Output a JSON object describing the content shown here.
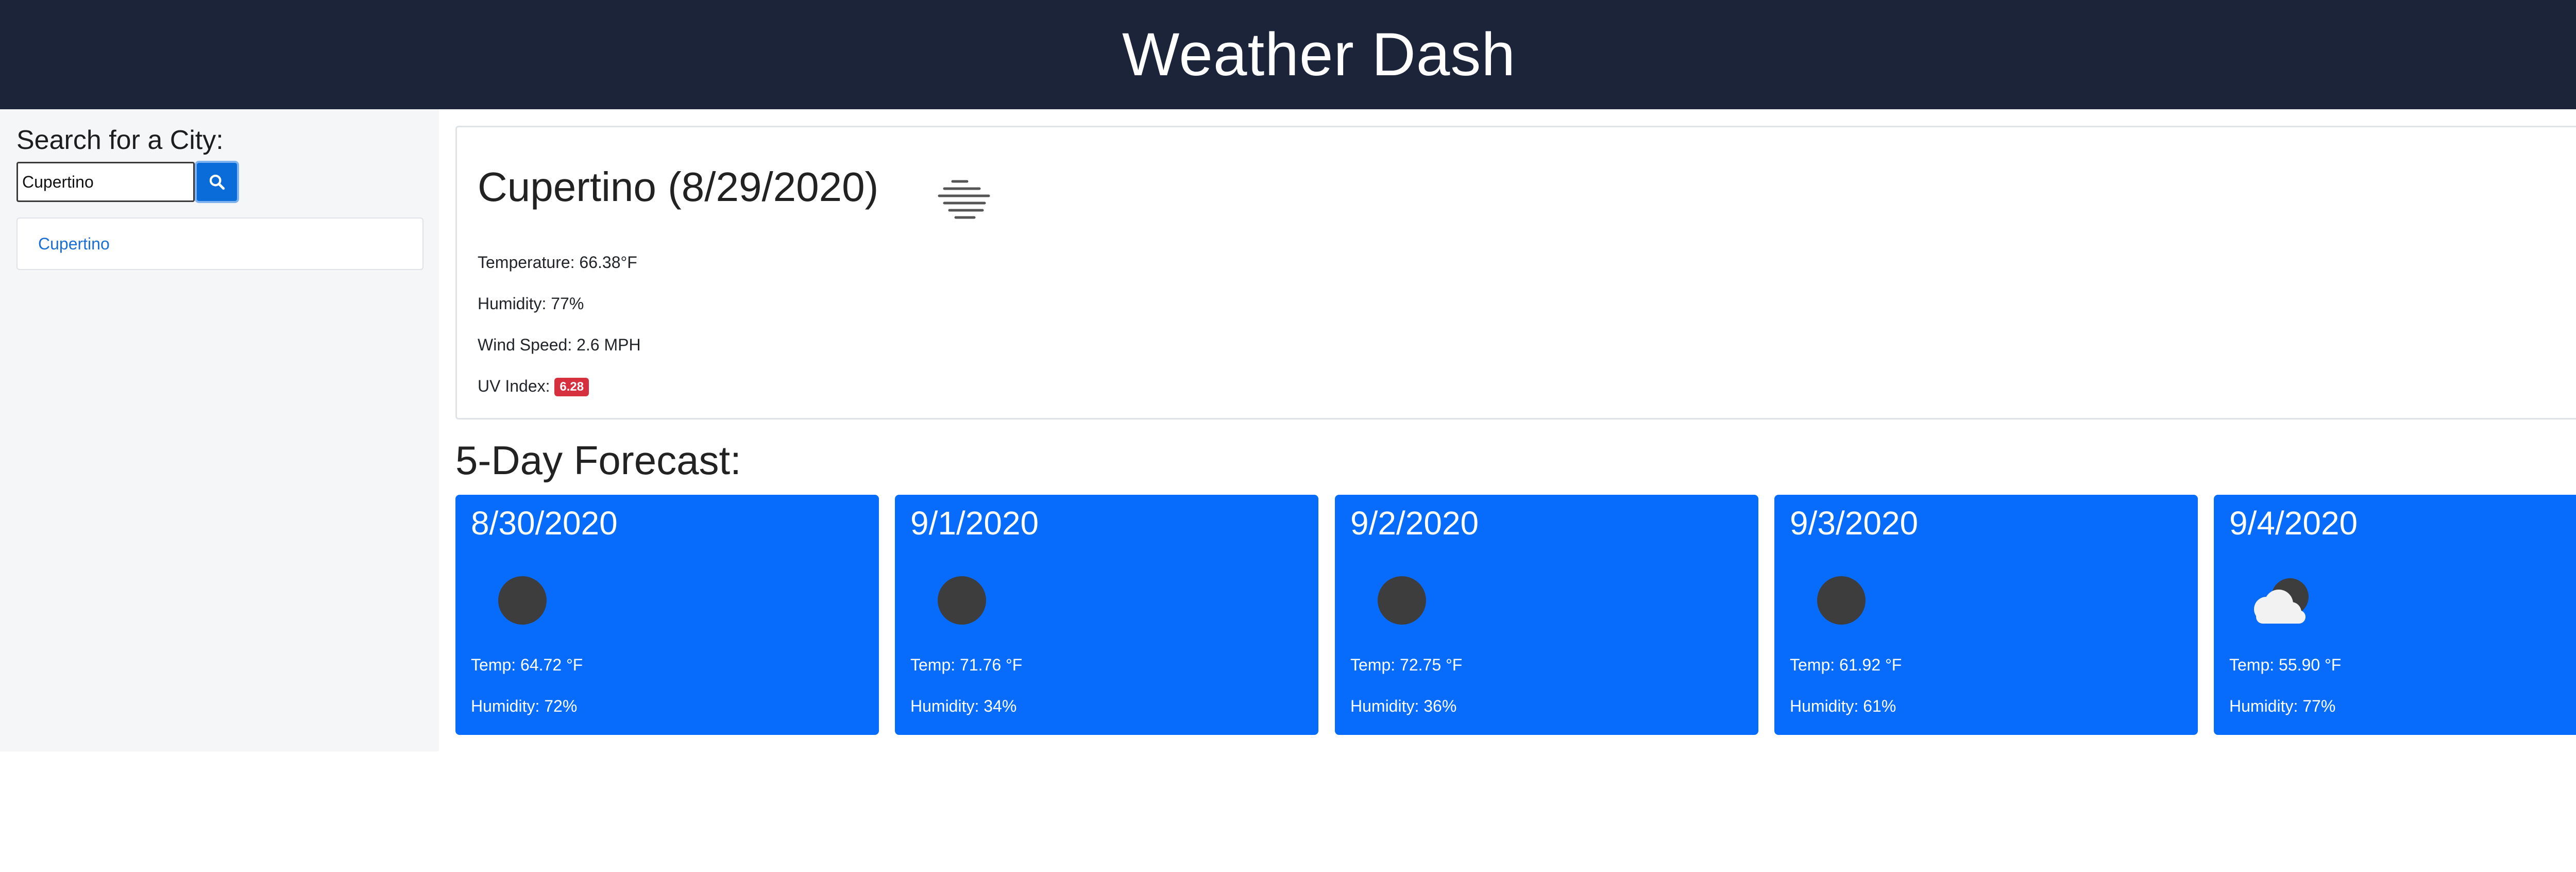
{
  "app": {
    "title": "Weather Dash"
  },
  "search": {
    "label": "Search for a City:",
    "value": "Cupertino",
    "button_icon": "search-icon",
    "history": [
      "Cupertino"
    ]
  },
  "current": {
    "heading": "Cupertino (8/29/2020)",
    "icon": "fog-icon",
    "temperature": "Temperature: 66.38°F",
    "humidity": "Humidity: 77%",
    "wind": "Wind Speed: 2.6 MPH",
    "uv_label": "UV Index: ",
    "uv_value": "6.28",
    "uv_color": "#d6303f"
  },
  "forecast": {
    "title": "5-Day Forecast:",
    "card_color": "#076cfc",
    "days": [
      {
        "date": "8/30/2020",
        "icon": "clear-night-icon",
        "temp": "Temp: 64.72 °F",
        "humidity": "Humidity: 72%"
      },
      {
        "date": "9/1/2020",
        "icon": "clear-night-icon",
        "temp": "Temp: 71.76 °F",
        "humidity": "Humidity: 34%"
      },
      {
        "date": "9/2/2020",
        "icon": "clear-night-icon",
        "temp": "Temp: 72.75 °F",
        "humidity": "Humidity: 36%"
      },
      {
        "date": "9/3/2020",
        "icon": "clear-night-icon",
        "temp": "Temp: 61.92 °F",
        "humidity": "Humidity: 61%"
      },
      {
        "date": "9/4/2020",
        "icon": "partly-cloudy-night-icon",
        "temp": "Temp: 55.90 °F",
        "humidity": "Humidity: 77%"
      }
    ]
  },
  "colors": {
    "header_bg": "#1c243a",
    "sidebar_bg": "#f5f6f8",
    "accent": "#0a6cd8",
    "link": "#1a6fd6"
  }
}
